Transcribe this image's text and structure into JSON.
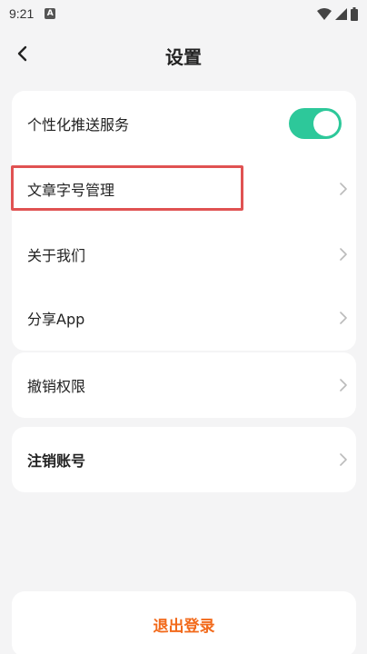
{
  "status_bar": {
    "time": "9:21",
    "notification_icon": "a-icon",
    "wifi_icon": "wifi-icon",
    "signal_icon": "signal-icon",
    "battery_icon": "battery-icon"
  },
  "header": {
    "title": "设置",
    "back_icon": "chevron-left-icon"
  },
  "settings": {
    "push_service": {
      "label": "个性化推送服务",
      "enabled": true
    },
    "font_size": {
      "label": "文章字号管理",
      "highlighted": true
    },
    "about": {
      "label": "关于我们"
    },
    "share": {
      "label": "分享App"
    },
    "revoke": {
      "label": "撤销权限"
    },
    "delete_account": {
      "label": "注销账号"
    }
  },
  "logout": {
    "label": "退出登录"
  },
  "colors": {
    "toggle_on": "#2dc89a",
    "logout_text": "#f26a1b",
    "highlight_border": "#e05252",
    "background": "#f4f4f5"
  }
}
